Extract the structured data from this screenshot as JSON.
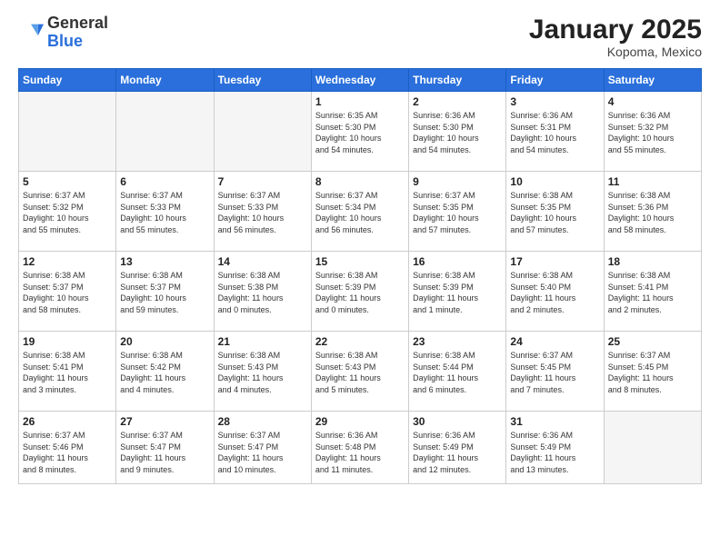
{
  "header": {
    "logo_general": "General",
    "logo_blue": "Blue",
    "title": "January 2025",
    "subtitle": "Kopoma, Mexico"
  },
  "weekdays": [
    "Sunday",
    "Monday",
    "Tuesday",
    "Wednesday",
    "Thursday",
    "Friday",
    "Saturday"
  ],
  "weeks": [
    [
      {
        "day": "",
        "info": ""
      },
      {
        "day": "",
        "info": ""
      },
      {
        "day": "",
        "info": ""
      },
      {
        "day": "1",
        "info": "Sunrise: 6:35 AM\nSunset: 5:30 PM\nDaylight: 10 hours\nand 54 minutes."
      },
      {
        "day": "2",
        "info": "Sunrise: 6:36 AM\nSunset: 5:30 PM\nDaylight: 10 hours\nand 54 minutes."
      },
      {
        "day": "3",
        "info": "Sunrise: 6:36 AM\nSunset: 5:31 PM\nDaylight: 10 hours\nand 54 minutes."
      },
      {
        "day": "4",
        "info": "Sunrise: 6:36 AM\nSunset: 5:32 PM\nDaylight: 10 hours\nand 55 minutes."
      }
    ],
    [
      {
        "day": "5",
        "info": "Sunrise: 6:37 AM\nSunset: 5:32 PM\nDaylight: 10 hours\nand 55 minutes."
      },
      {
        "day": "6",
        "info": "Sunrise: 6:37 AM\nSunset: 5:33 PM\nDaylight: 10 hours\nand 55 minutes."
      },
      {
        "day": "7",
        "info": "Sunrise: 6:37 AM\nSunset: 5:33 PM\nDaylight: 10 hours\nand 56 minutes."
      },
      {
        "day": "8",
        "info": "Sunrise: 6:37 AM\nSunset: 5:34 PM\nDaylight: 10 hours\nand 56 minutes."
      },
      {
        "day": "9",
        "info": "Sunrise: 6:37 AM\nSunset: 5:35 PM\nDaylight: 10 hours\nand 57 minutes."
      },
      {
        "day": "10",
        "info": "Sunrise: 6:38 AM\nSunset: 5:35 PM\nDaylight: 10 hours\nand 57 minutes."
      },
      {
        "day": "11",
        "info": "Sunrise: 6:38 AM\nSunset: 5:36 PM\nDaylight: 10 hours\nand 58 minutes."
      }
    ],
    [
      {
        "day": "12",
        "info": "Sunrise: 6:38 AM\nSunset: 5:37 PM\nDaylight: 10 hours\nand 58 minutes."
      },
      {
        "day": "13",
        "info": "Sunrise: 6:38 AM\nSunset: 5:37 PM\nDaylight: 10 hours\nand 59 minutes."
      },
      {
        "day": "14",
        "info": "Sunrise: 6:38 AM\nSunset: 5:38 PM\nDaylight: 11 hours\nand 0 minutes."
      },
      {
        "day": "15",
        "info": "Sunrise: 6:38 AM\nSunset: 5:39 PM\nDaylight: 11 hours\nand 0 minutes."
      },
      {
        "day": "16",
        "info": "Sunrise: 6:38 AM\nSunset: 5:39 PM\nDaylight: 11 hours\nand 1 minute."
      },
      {
        "day": "17",
        "info": "Sunrise: 6:38 AM\nSunset: 5:40 PM\nDaylight: 11 hours\nand 2 minutes."
      },
      {
        "day": "18",
        "info": "Sunrise: 6:38 AM\nSunset: 5:41 PM\nDaylight: 11 hours\nand 2 minutes."
      }
    ],
    [
      {
        "day": "19",
        "info": "Sunrise: 6:38 AM\nSunset: 5:41 PM\nDaylight: 11 hours\nand 3 minutes."
      },
      {
        "day": "20",
        "info": "Sunrise: 6:38 AM\nSunset: 5:42 PM\nDaylight: 11 hours\nand 4 minutes."
      },
      {
        "day": "21",
        "info": "Sunrise: 6:38 AM\nSunset: 5:43 PM\nDaylight: 11 hours\nand 4 minutes."
      },
      {
        "day": "22",
        "info": "Sunrise: 6:38 AM\nSunset: 5:43 PM\nDaylight: 11 hours\nand 5 minutes."
      },
      {
        "day": "23",
        "info": "Sunrise: 6:38 AM\nSunset: 5:44 PM\nDaylight: 11 hours\nand 6 minutes."
      },
      {
        "day": "24",
        "info": "Sunrise: 6:37 AM\nSunset: 5:45 PM\nDaylight: 11 hours\nand 7 minutes."
      },
      {
        "day": "25",
        "info": "Sunrise: 6:37 AM\nSunset: 5:45 PM\nDaylight: 11 hours\nand 8 minutes."
      }
    ],
    [
      {
        "day": "26",
        "info": "Sunrise: 6:37 AM\nSunset: 5:46 PM\nDaylight: 11 hours\nand 8 minutes."
      },
      {
        "day": "27",
        "info": "Sunrise: 6:37 AM\nSunset: 5:47 PM\nDaylight: 11 hours\nand 9 minutes."
      },
      {
        "day": "28",
        "info": "Sunrise: 6:37 AM\nSunset: 5:47 PM\nDaylight: 11 hours\nand 10 minutes."
      },
      {
        "day": "29",
        "info": "Sunrise: 6:36 AM\nSunset: 5:48 PM\nDaylight: 11 hours\nand 11 minutes."
      },
      {
        "day": "30",
        "info": "Sunrise: 6:36 AM\nSunset: 5:49 PM\nDaylight: 11 hours\nand 12 minutes."
      },
      {
        "day": "31",
        "info": "Sunrise: 6:36 AM\nSunset: 5:49 PM\nDaylight: 11 hours\nand 13 minutes."
      },
      {
        "day": "",
        "info": ""
      }
    ]
  ]
}
